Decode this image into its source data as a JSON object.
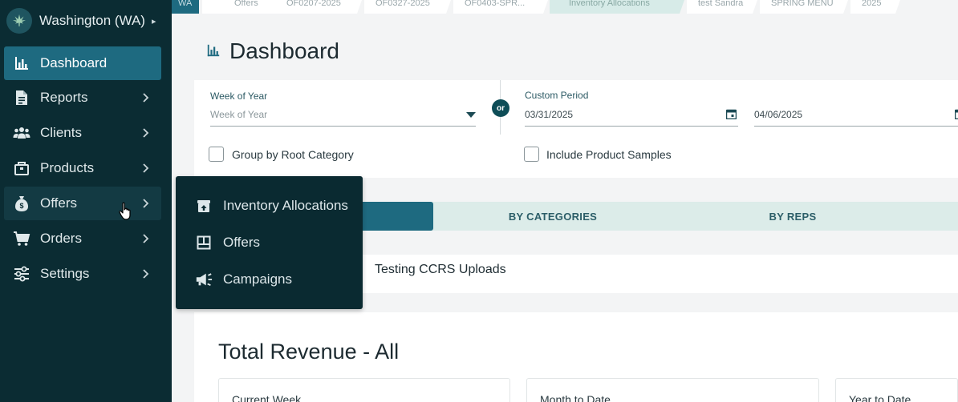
{
  "org": {
    "name": "Washington (WA)",
    "logo_icon": "cannabis-leaf-icon"
  },
  "sidebar": {
    "items": [
      {
        "label": "Dashboard",
        "icon": "bar-chart-icon",
        "active": true
      },
      {
        "label": "Reports",
        "icon": "document-icon"
      },
      {
        "label": "Clients",
        "icon": "users-icon"
      },
      {
        "label": "Products",
        "icon": "box-icon"
      },
      {
        "label": "Offers",
        "icon": "money-bag-icon",
        "hover": true
      },
      {
        "label": "Orders",
        "icon": "cart-icon"
      },
      {
        "label": "Settings",
        "icon": "sliders-icon"
      }
    ]
  },
  "flyout": {
    "items": [
      {
        "label": "Inventory Allocations",
        "icon": "archive-icon"
      },
      {
        "label": "Offers",
        "icon": "grid-icon"
      },
      {
        "label": "Campaigns",
        "icon": "megaphone-icon"
      }
    ]
  },
  "tabs": {
    "wa": "WA",
    "items": [
      "Offers",
      "OF0207-2025",
      "OF0327-2025",
      "OF0403-SPR...",
      "Inventory Allocations",
      "test Sandra",
      "SPRING MENU",
      "2025"
    ]
  },
  "page": {
    "title": "Dashboard"
  },
  "filters": {
    "week_label": "Week of Year",
    "week_placeholder": "Week of Year",
    "or": "or",
    "custom_label": "Custom Period",
    "start_date": "03/31/2025",
    "end_date": "04/06/2025",
    "group_root": "Group by Root Category",
    "include_samples": "Include Product Samples"
  },
  "segments": {
    "categories": "BY CATEGORIES",
    "reps": "BY REPS"
  },
  "campaign": {
    "name": "Testing CCRS Uploads"
  },
  "revenue": {
    "title": "Total Revenue - All",
    "current_week": "Current Week",
    "month_to_date": "Month to Date",
    "year_to_date": "Year to Date"
  },
  "colors": {
    "sidebar": "#0b2c33",
    "active": "#1e6a80",
    "accent": "#0e4d57"
  }
}
